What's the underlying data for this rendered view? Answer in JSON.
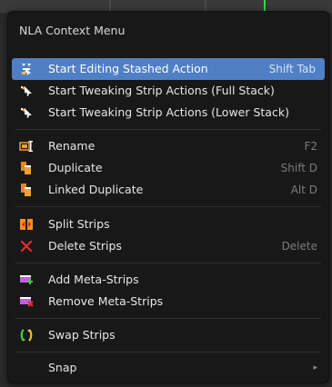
{
  "menu": {
    "title": "NLA Context Menu",
    "items": [
      {
        "id": "start-editing-stashed-action",
        "label": "Start Editing Stashed Action",
        "shortcut": "Shift Tab",
        "icon": "tweak-icon",
        "active": true
      },
      {
        "id": "start-tweaking-full",
        "label": "Start Tweaking Strip Actions (Full Stack)",
        "shortcut": "",
        "icon": "tweak-icon"
      },
      {
        "id": "start-tweaking-lower",
        "label": "Start Tweaking Strip Actions (Lower Stack)",
        "shortcut": "",
        "icon": "tweak-icon"
      },
      {
        "id": "rename",
        "label": "Rename",
        "shortcut": "F2",
        "icon": "rename-icon"
      },
      {
        "id": "duplicate",
        "label": "Duplicate",
        "shortcut": "Shift D",
        "icon": "duplicate-icon"
      },
      {
        "id": "linked-duplicate",
        "label": "Linked Duplicate",
        "shortcut": "Alt D",
        "icon": "linked-duplicate-icon"
      },
      {
        "id": "split-strips",
        "label": "Split Strips",
        "shortcut": "",
        "icon": "split-icon"
      },
      {
        "id": "delete-strips",
        "label": "Delete Strips",
        "shortcut": "Delete",
        "icon": "delete-icon"
      },
      {
        "id": "add-meta-strips",
        "label": "Add Meta-Strips",
        "shortcut": "",
        "icon": "add-meta-icon"
      },
      {
        "id": "remove-meta-strips",
        "label": "Remove Meta-Strips",
        "shortcut": "",
        "icon": "remove-meta-icon"
      },
      {
        "id": "swap-strips",
        "label": "Swap Strips",
        "shortcut": "",
        "icon": "swap-icon"
      },
      {
        "id": "snap",
        "label": "Snap",
        "shortcut": "",
        "icon": "",
        "submenu_arrow": "▸"
      }
    ]
  },
  "colors": {
    "menu_bg": "#181818",
    "highlight": "#4f7fc4",
    "text": "#e6e6e6",
    "shortcut_text": "#7b7b7b"
  }
}
